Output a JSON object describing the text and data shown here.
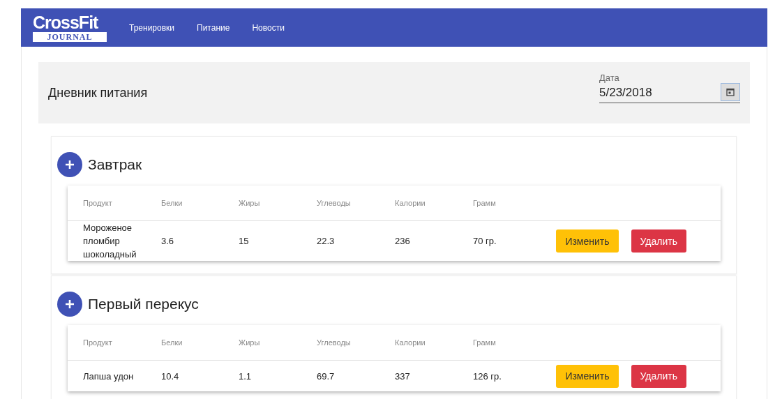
{
  "logo": {
    "top": "CrossFit",
    "bottom": "JOURNAL"
  },
  "nav": [
    {
      "label": "Тренировки"
    },
    {
      "label": "Питание"
    },
    {
      "label": "Новости"
    }
  ],
  "diary": {
    "title": "Дневник питания",
    "date_label": "Дата",
    "date_value": "5/23/2018"
  },
  "meals": [
    {
      "title": "Завтрак",
      "columns": [
        "Продукт",
        "Белки",
        "Жиры",
        "Углеводы",
        "Калории",
        "Грамм"
      ],
      "rows": [
        {
          "cells": [
            "Мороженое пломбир шоколадный",
            "3.6",
            "15",
            "22.3",
            "236",
            "70 гр."
          ],
          "edit": "Изменить",
          "delete": "Удалить"
        }
      ]
    },
    {
      "title": "Первый перекус",
      "columns": [
        "Продукт",
        "Белки",
        "Жиры",
        "Углеводы",
        "Калории",
        "Грамм"
      ],
      "rows": [
        {
          "cells": [
            "Лапша удон",
            "10.4",
            "1.1",
            "69.7",
            "337",
            "126 гр."
          ],
          "edit": "Изменить",
          "delete": "Удалить"
        }
      ]
    }
  ]
}
